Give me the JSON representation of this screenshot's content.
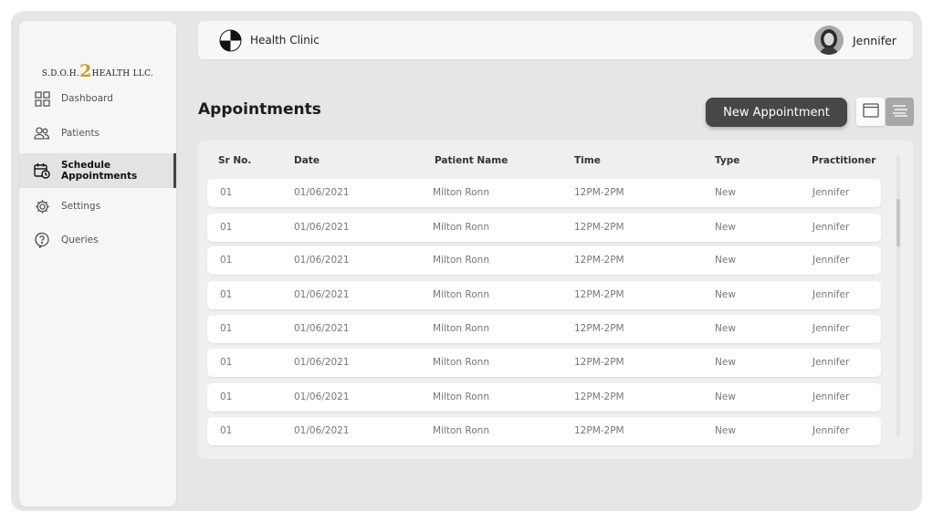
{
  "sidebar": {
    "logo": {
      "prefix": "S.D.O.H.",
      "digit": "2",
      "suffix": "HEALTH LLC."
    },
    "items": [
      {
        "label": "Dashboard",
        "icon": "grid-icon",
        "active": false
      },
      {
        "label": "Patients",
        "icon": "users-icon",
        "active": false
      },
      {
        "label": "Schedule Appointments",
        "icon": "calendar-clock-icon",
        "active": true
      },
      {
        "label": "Settings",
        "icon": "gear-icon",
        "active": false
      },
      {
        "label": "Queries",
        "icon": "question-icon",
        "active": false
      }
    ]
  },
  "topbar": {
    "clinic_name": "Health Clinic",
    "user_name": "Jennifer"
  },
  "main": {
    "title": "Appointments",
    "new_button": "New Appointment",
    "view_toggle": {
      "calendar_icon": "calendar-icon",
      "list_icon": "list-icon",
      "active": "list"
    }
  },
  "table": {
    "headers": [
      "Sr No.",
      "Date",
      "Patient Name",
      "Time",
      "Type",
      "Practitioner"
    ],
    "rows": [
      [
        "01",
        "01/06/2021",
        "Milton Ronn",
        "12PM-2PM",
        "New",
        "Jennifer"
      ],
      [
        "01",
        "01/06/2021",
        "Milton Ronn",
        "12PM-2PM",
        "New",
        "Jennifer"
      ],
      [
        "01",
        "01/06/2021",
        "Milton Ronn",
        "12PM-2PM",
        "New",
        "Jennifer"
      ],
      [
        "01",
        "01/06/2021",
        "Milton Ronn",
        "12PM-2PM",
        "New",
        "Jennifer"
      ],
      [
        "01",
        "01/06/2021",
        "Milton Ronn",
        "12PM-2PM",
        "New",
        "Jennifer"
      ],
      [
        "01",
        "01/06/2021",
        "Milton Ronn",
        "12PM-2PM",
        "New",
        "Jennifer"
      ],
      [
        "01",
        "01/06/2021",
        "Milton Ronn",
        "12PM-2PM",
        "New",
        "Jennifer"
      ],
      [
        "01",
        "01/06/2021",
        "Milton Ronn",
        "12PM-2PM",
        "New",
        "Jennifer"
      ]
    ]
  },
  "colors": {
    "accent": "#474747",
    "logo_digit": "#c8a21a",
    "background": "#e6e6e6"
  }
}
